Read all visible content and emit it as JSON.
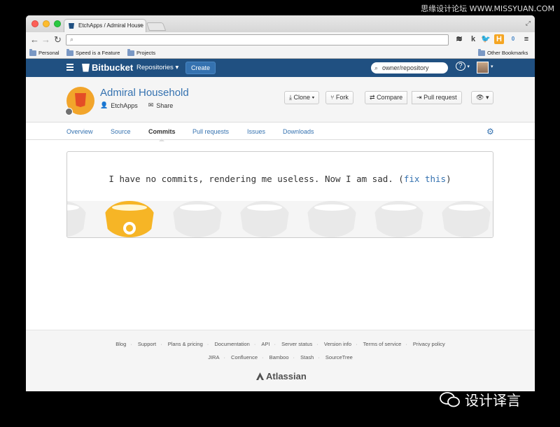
{
  "watermark": {
    "top": "思缘设计论坛 WWW.MISSYUAN.COM",
    "bottom": "设计译言"
  },
  "browser": {
    "tab_title": "EtchApps / Admiral House",
    "url": "",
    "bookmarks": [
      "Personal",
      "Speed is a Feature",
      "Projects"
    ],
    "other_bookmarks": "Other Bookmarks",
    "extensions": [
      "buffer-icon",
      "klout-icon",
      "twitter-icon",
      "hootsuite-icon",
      "notification-icon",
      "menu-icon"
    ],
    "ext_badge": "0"
  },
  "header": {
    "logo": "Bitbucket",
    "repositories": "Repositories",
    "create": "Create",
    "search_placeholder": "owner/repository",
    "help": "?"
  },
  "repo": {
    "name": "Admiral Household",
    "owner": "EtchApps",
    "share": "Share",
    "actions": {
      "clone": "Clone",
      "fork": "Fork",
      "compare": "Compare",
      "pull_request": "Pull request"
    }
  },
  "nav": {
    "items": [
      "Overview",
      "Source",
      "Commits",
      "Pull requests",
      "Issues",
      "Downloads"
    ],
    "active": "Commits"
  },
  "empty_state": {
    "message": "I have no commits, rendering me useless. Now I am sad.",
    "open_paren": " (",
    "link": "fix this",
    "close_paren": ")"
  },
  "footer": {
    "row1": [
      "Blog",
      "Support",
      "Plans & pricing",
      "Documentation",
      "API",
      "Server status",
      "Version info",
      "Terms of service",
      "Privacy policy"
    ],
    "row2": [
      "JIRA",
      "Confluence",
      "Bamboo",
      "Stash",
      "SourceTree"
    ],
    "brand": "Atlassian"
  },
  "colors": {
    "header_bg": "#205081",
    "link": "#3572b0",
    "accent_yellow": "#f6b526"
  }
}
